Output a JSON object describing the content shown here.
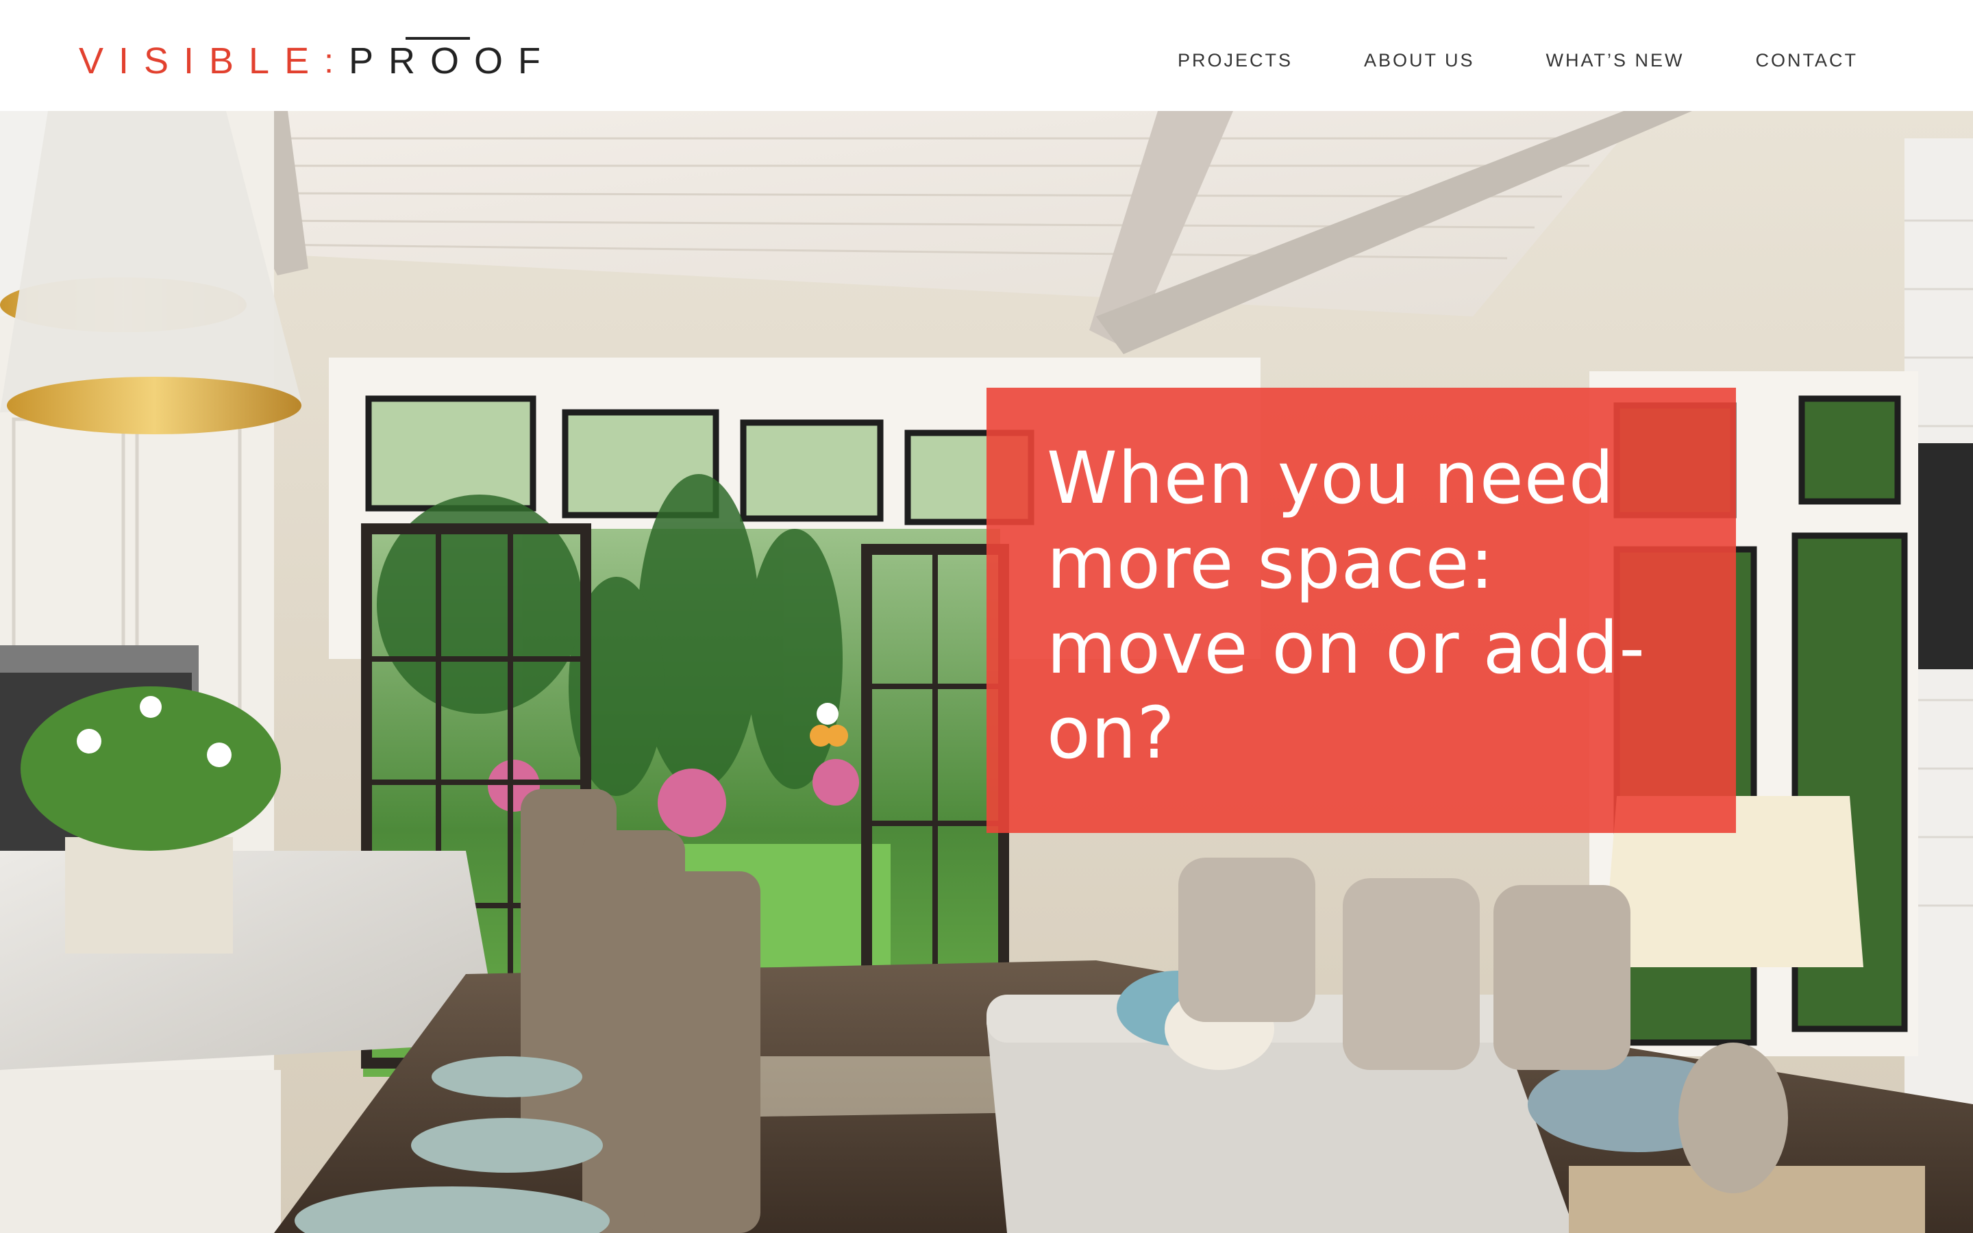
{
  "brand": {
    "logo_part1": "VISIBLE",
    "logo_separator": ":",
    "logo_part2": "PROOF",
    "accent_color": "#e2412f",
    "text_color": "#222222"
  },
  "nav": {
    "items": [
      {
        "label": "PROJECTS"
      },
      {
        "label": "ABOUT US"
      },
      {
        "label": "WHAT’S NEW"
      },
      {
        "label": "CONTACT"
      }
    ]
  },
  "hero": {
    "headline": "When you need more space: move on or add-on?",
    "headline_box_color": "#ec4538",
    "image_subject": "bright open kitchen and family room addition with glass doors to garden"
  }
}
